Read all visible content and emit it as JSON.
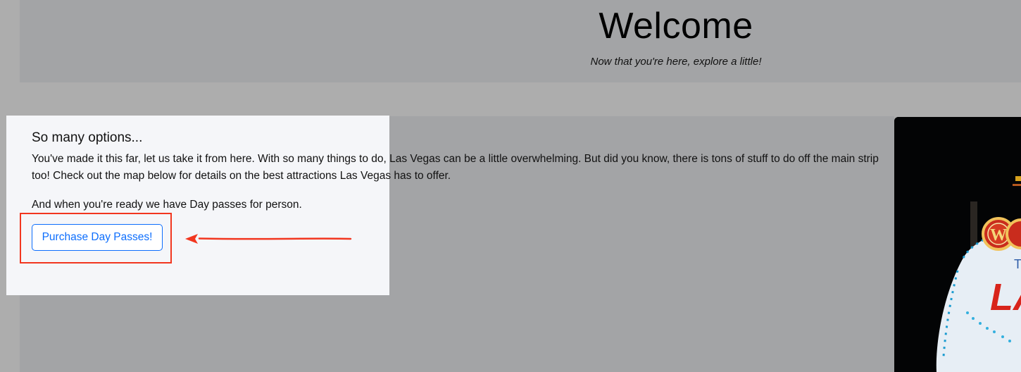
{
  "header": {
    "title": "Welcome",
    "subtitle": "Now that you're here, explore a little!"
  },
  "options": {
    "heading": "So many options...",
    "body": "You've made it this far, let us take it from here. With so many things to do, Las Vegas can be a little overwhelming. But did you know, there is tons of stuff to do off the main strip too! Check out the map below for details on the best attractions Las Vegas has to offer.",
    "cta_text": "And when you're ready we have Day passes for person.",
    "button_label": "Purchase Day Passes!"
  },
  "sign_image": {
    "letter_w": "W",
    "letter_partial": "T",
    "word_partial": "LA"
  },
  "colors": {
    "accent": "#0d6efd",
    "annotation": "#f2361f",
    "overlay": "#a3a4a6",
    "spotlight": "#f5f6f9"
  }
}
